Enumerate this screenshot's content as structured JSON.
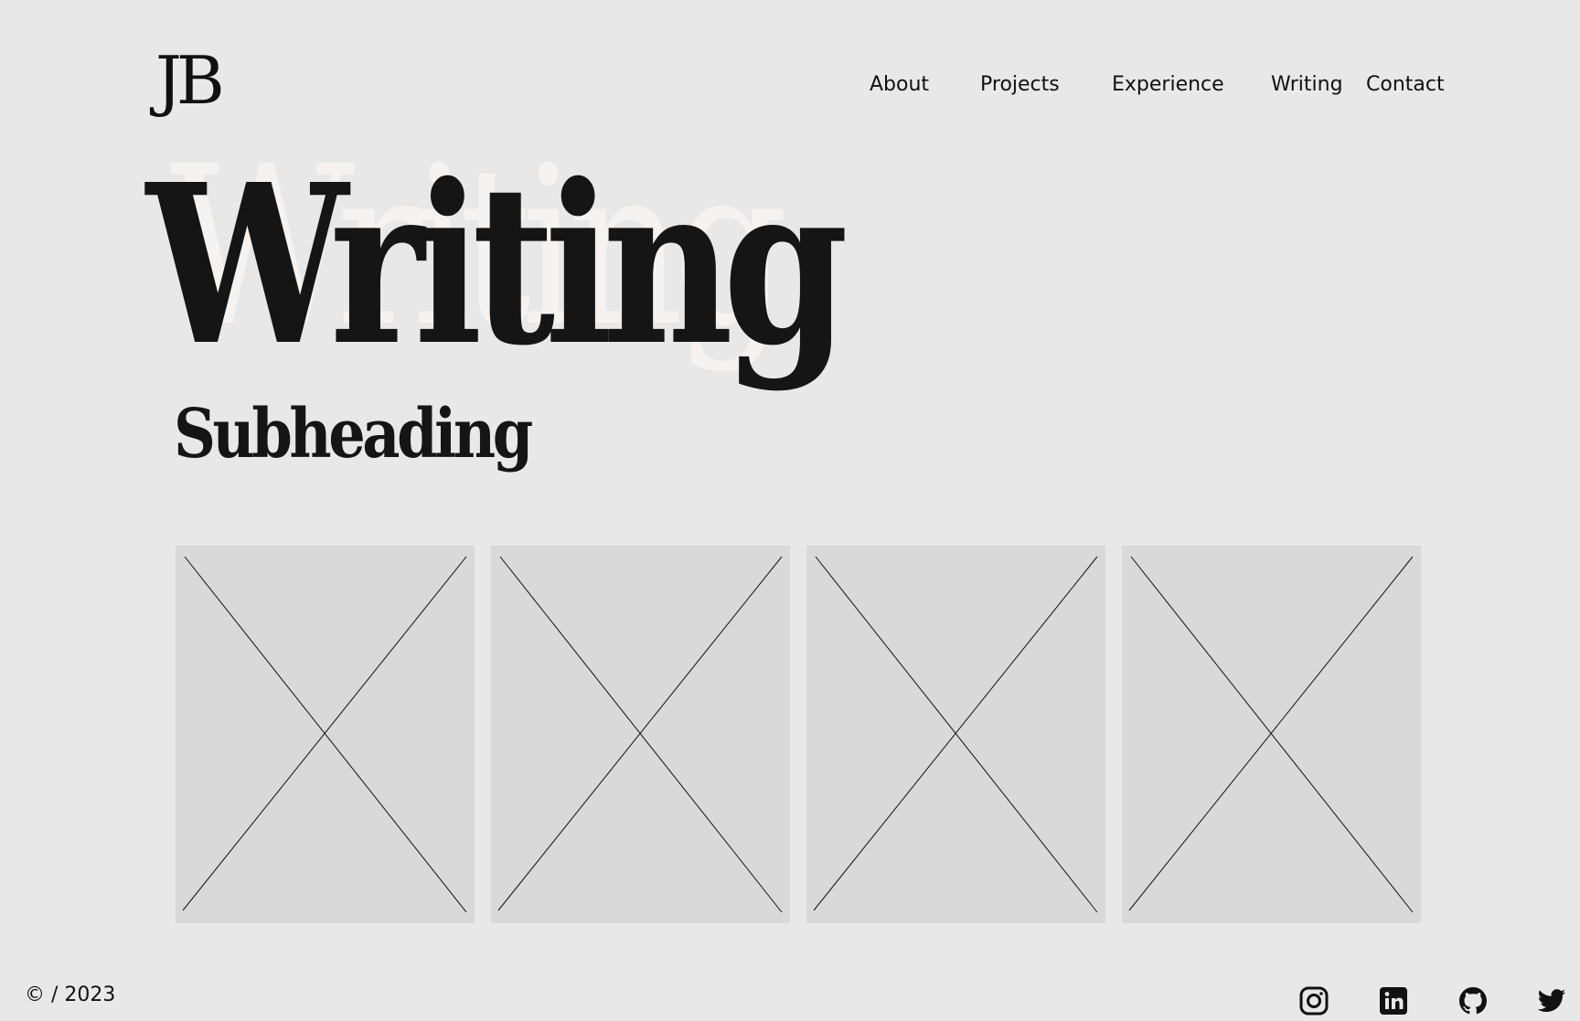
{
  "header": {
    "logo_text": "JB",
    "nav": [
      {
        "label": "About"
      },
      {
        "label": "Projects"
      },
      {
        "label": "Experience"
      },
      {
        "label": "Writing"
      },
      {
        "label": "Contact"
      }
    ]
  },
  "hero": {
    "title": "Writing",
    "ghost_title": "Writing",
    "subheading": "Subheading"
  },
  "gallery": {
    "items": [
      {
        "label": ""
      },
      {
        "label": ""
      },
      {
        "label": ""
      },
      {
        "label": ""
      }
    ]
  },
  "footer": {
    "copyright": "© / 2023",
    "social": [
      {
        "name": "instagram-icon"
      },
      {
        "name": "linkedin-icon"
      },
      {
        "name": "github-icon"
      },
      {
        "name": "twitter-icon"
      }
    ]
  },
  "colors": {
    "background": "#e8e8e8",
    "text": "#111111",
    "placeholder": "#d9d9d9",
    "ghost_text": "#f6f2ef"
  }
}
